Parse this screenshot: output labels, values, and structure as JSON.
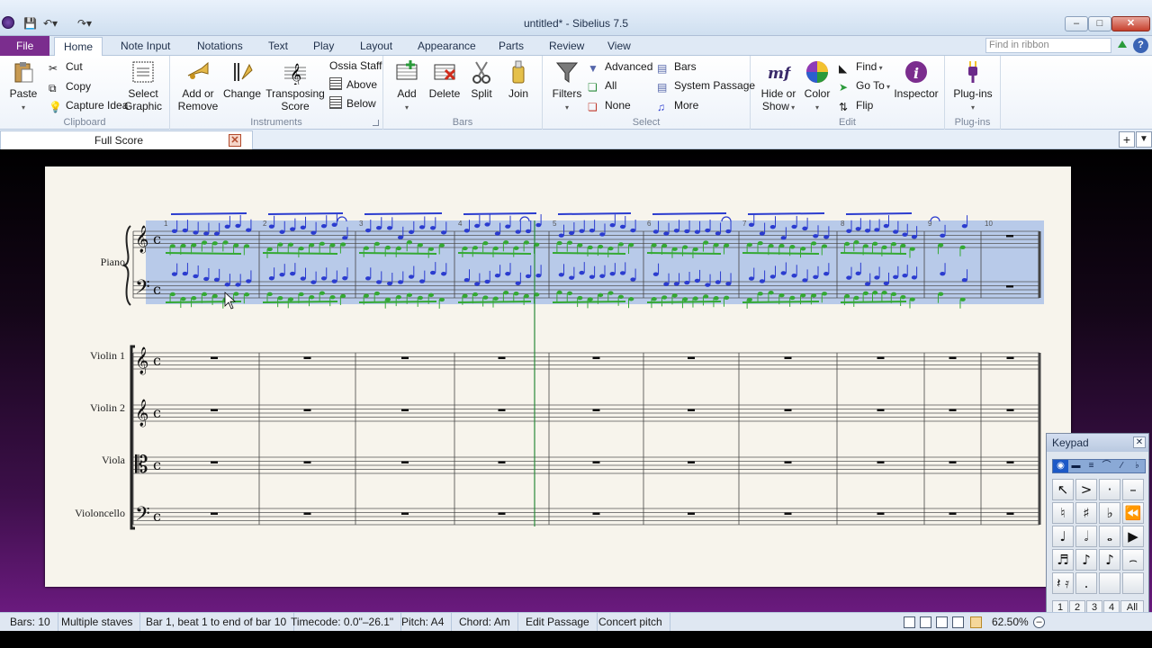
{
  "window": {
    "title": "untitled* - Sibelius 7.5",
    "quick_access": [
      "save-icon",
      "undo-icon",
      "redo-icon"
    ],
    "controls": {
      "minimize": "–",
      "maximize": "□",
      "close": "✕"
    }
  },
  "ribbon_tabs": [
    "File",
    "Home",
    "Note Input",
    "Notations",
    "Text",
    "Play",
    "Layout",
    "Appearance",
    "Parts",
    "Review",
    "View"
  ],
  "active_tab": "Home",
  "search_placeholder": "Find in ribbon",
  "groups": {
    "clipboard": {
      "label": "Clipboard",
      "paste": "Paste",
      "cut": "Cut",
      "copy": "Copy",
      "capture_idea": "Capture Idea",
      "select_graphic_1": "Select",
      "select_graphic_2": "Graphic"
    },
    "instruments": {
      "label": "Instruments",
      "add_remove_1": "Add or",
      "add_remove_2": "Remove",
      "change": "Change",
      "transposing_1": "Transposing",
      "transposing_2": "Score",
      "ossia_staff": "Ossia Staff",
      "above": "Above",
      "below": "Below"
    },
    "bars": {
      "label": "Bars",
      "add": "Add",
      "delete": "Delete",
      "split": "Split",
      "join": "Join"
    },
    "select": {
      "label": "Select",
      "filters": "Filters",
      "advanced": "Advanced",
      "all": "All",
      "none": "None",
      "bars": "Bars",
      "system_passage": "System Passage",
      "more": "More"
    },
    "edit": {
      "label": "Edit",
      "hide_show_1": "Hide or",
      "hide_show_2": "Show",
      "color": "Color",
      "find": "Find",
      "go_to": "Go To",
      "flip": "Flip",
      "inspector": "Inspector"
    },
    "plugins": {
      "label": "Plug-ins",
      "plugins": "Plug-ins"
    }
  },
  "document_tab": "Full Score",
  "score": {
    "instruments": [
      "Piano",
      "Violin 1",
      "Violin 2",
      "Viola",
      "Violoncello"
    ],
    "bar_numbers": [
      "1",
      "2",
      "3",
      "4",
      "5",
      "6",
      "7",
      "8",
      "9",
      "10"
    ],
    "time_signature": "c"
  },
  "keypad": {
    "title": "Keypad",
    "mode_icons": [
      "eye-icon",
      "rest-icon",
      "repeat-icon",
      "tie-icon",
      "slash-icon",
      "flat-icon"
    ],
    "keys": [
      [
        "↖",
        ">",
        "·",
        "–"
      ],
      [
        "♮",
        "♯",
        "♭",
        "⏪"
      ],
      [
        "♩",
        "𝅗𝅥",
        "𝅝",
        "▶"
      ],
      [
        "♬",
        "♪",
        "♪",
        "⌢"
      ],
      [
        "𝄽 𝄿",
        ".",
        "",
        ""
      ]
    ],
    "layouts": [
      "1",
      "2",
      "3",
      "4",
      "All"
    ]
  },
  "status": {
    "bars": "Bars: 10",
    "staves": "Multiple staves",
    "selection": "Bar 1, beat 1 to end of bar 10",
    "timecode": "Timecode: 0.0\"–26.1\"",
    "pitch": "Pitch: A4",
    "chord": "Chord: Am",
    "mode": "Edit Passage",
    "pitch_mode": "Concert pitch",
    "zoom": "62.50%"
  },
  "colors": {
    "file_tab": "#7b2d8e",
    "selection": "#9cb8e8",
    "voice1": "#2b3ccf",
    "voice2": "#34a833",
    "playline": "#2a8a3a"
  }
}
